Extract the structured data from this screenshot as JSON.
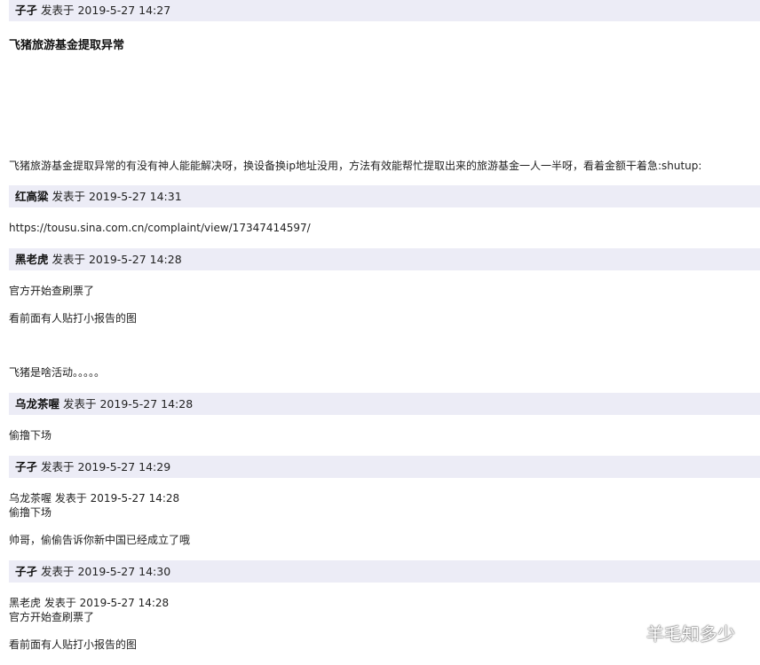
{
  "posts": [
    {
      "author": "子孑",
      "meta": "发表于 2019-5-27 14:27",
      "title": "飞猪旅游基金提取异常",
      "lines": [
        "飞猪旅游基金提取异常的有没有神人能能解决呀，换设备换ip地址没用，方法有效能帮忙提取出来的旅游基金一人一半呀，看着金额干着急:shutup:"
      ]
    },
    {
      "author": "红高粱",
      "meta": "发表于 2019-5-27 14:31",
      "lines": [
        "https://tousu.sina.com.cn/complaint/view/17347414597/"
      ]
    },
    {
      "author": "黑老虎",
      "meta": "发表于 2019-5-27 14:28",
      "lines": [
        "官方开始查刷票了",
        "看前面有人贴打小报告的图",
        "飞猪是啥活动。。。。。"
      ]
    },
    {
      "author": "乌龙茶喔",
      "meta": "发表于 2019-5-27 14:28",
      "lines": [
        "偷撸下场"
      ]
    },
    {
      "author": "子孑",
      "meta": "发表于 2019-5-27 14:29",
      "quote_author": "乌龙茶喔",
      "quote_meta": "发表于 2019-5-27 14:28",
      "quote_text": "偷撸下场",
      "lines": [
        "帅哥，偷偷告诉你新中国已经成立了哦"
      ]
    },
    {
      "author": "子孑",
      "meta": "发表于 2019-5-27 14:30",
      "quote_author": "黑老虎",
      "quote_meta": "发表于 2019-5-27 14:28",
      "quote_text": "官方开始查刷票了",
      "lines": [
        "看前面有人贴打小报告的图"
      ]
    }
  ],
  "watermark": {
    "text": "羊毛知多少",
    "icon": "wechat-icon"
  }
}
